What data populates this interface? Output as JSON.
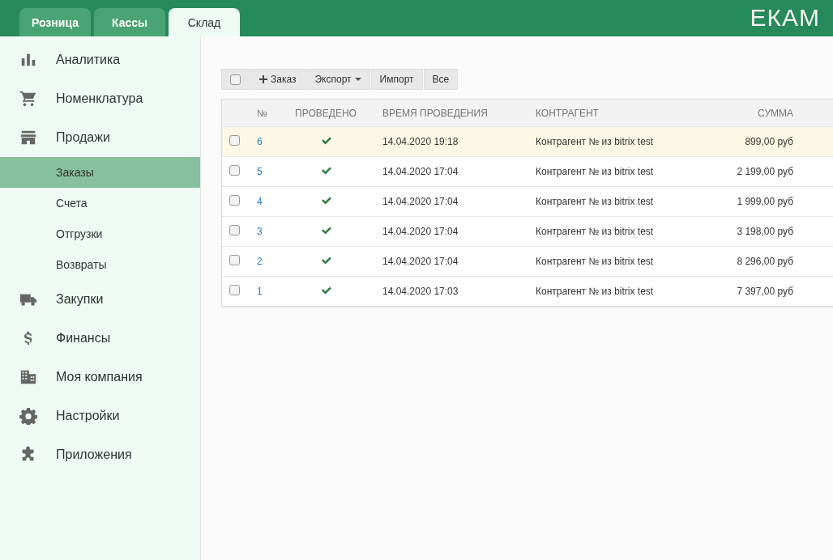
{
  "top_tabs": [
    {
      "label": "Розница",
      "selected": false
    },
    {
      "label": "Кассы",
      "selected": false
    },
    {
      "label": "Склад",
      "selected": true
    }
  ],
  "logo": "ЕКАМ",
  "sidebar": {
    "items": [
      {
        "label": "Аналитика",
        "kind": "chart"
      },
      {
        "label": "Номенклатура",
        "kind": "cart"
      },
      {
        "label": "Продажи",
        "kind": "store",
        "children": [
          {
            "label": "Заказы",
            "selected": true
          },
          {
            "label": "Счета",
            "selected": false
          },
          {
            "label": "Отгрузки",
            "selected": false
          },
          {
            "label": "Возвраты",
            "selected": false
          }
        ]
      },
      {
        "label": "Закупки",
        "kind": "truck"
      },
      {
        "label": "Финансы",
        "kind": "dollar"
      },
      {
        "label": "Моя компания",
        "kind": "building"
      },
      {
        "label": "Настройки",
        "kind": "gear"
      },
      {
        "label": "Приложения",
        "kind": "puzzle"
      }
    ]
  },
  "toolbar": {
    "select_all_checked": false,
    "buttons": [
      {
        "label": "Заказ",
        "kind": "add"
      },
      {
        "label": "Экспорт",
        "kind": "dropdown"
      },
      {
        "label": "Импорт",
        "kind": "plain"
      },
      {
        "label": "Все",
        "kind": "plain"
      }
    ]
  },
  "table": {
    "columns": [
      "№",
      "ПРОВЕДЕНО",
      "ВРЕМЯ ПРОВЕДЕНИЯ",
      "КОНТРАГЕНТ",
      "СУММА"
    ],
    "rows": [
      {
        "checked": false,
        "highlighted": true,
        "number": "6",
        "posted": true,
        "time": "14.04.2020 19:18",
        "counterparty": "Контрагент № из bitrix test",
        "sum": "899,00 руб"
      },
      {
        "checked": false,
        "highlighted": false,
        "number": "5",
        "posted": true,
        "time": "14.04.2020 17:04",
        "counterparty": "Контрагент № из bitrix test",
        "sum": "2 199,00 руб"
      },
      {
        "checked": false,
        "highlighted": false,
        "number": "4",
        "posted": true,
        "time": "14.04.2020 17:04",
        "counterparty": "Контрагент № из bitrix test",
        "sum": "1 999,00 руб"
      },
      {
        "checked": false,
        "highlighted": false,
        "number": "3",
        "posted": true,
        "time": "14.04.2020 17:04",
        "counterparty": "Контрагент № из bitrix test",
        "sum": "3 198,00 руб"
      },
      {
        "checked": false,
        "highlighted": false,
        "number": "2",
        "posted": true,
        "time": "14.04.2020 17:04",
        "counterparty": "Контрагент № из bitrix test",
        "sum": "8 296,00 руб"
      },
      {
        "checked": false,
        "highlighted": false,
        "number": "1",
        "posted": true,
        "time": "14.04.2020 17:03",
        "counterparty": "Контрагент № из bitrix test",
        "sum": "7 397,00 руб"
      }
    ]
  }
}
